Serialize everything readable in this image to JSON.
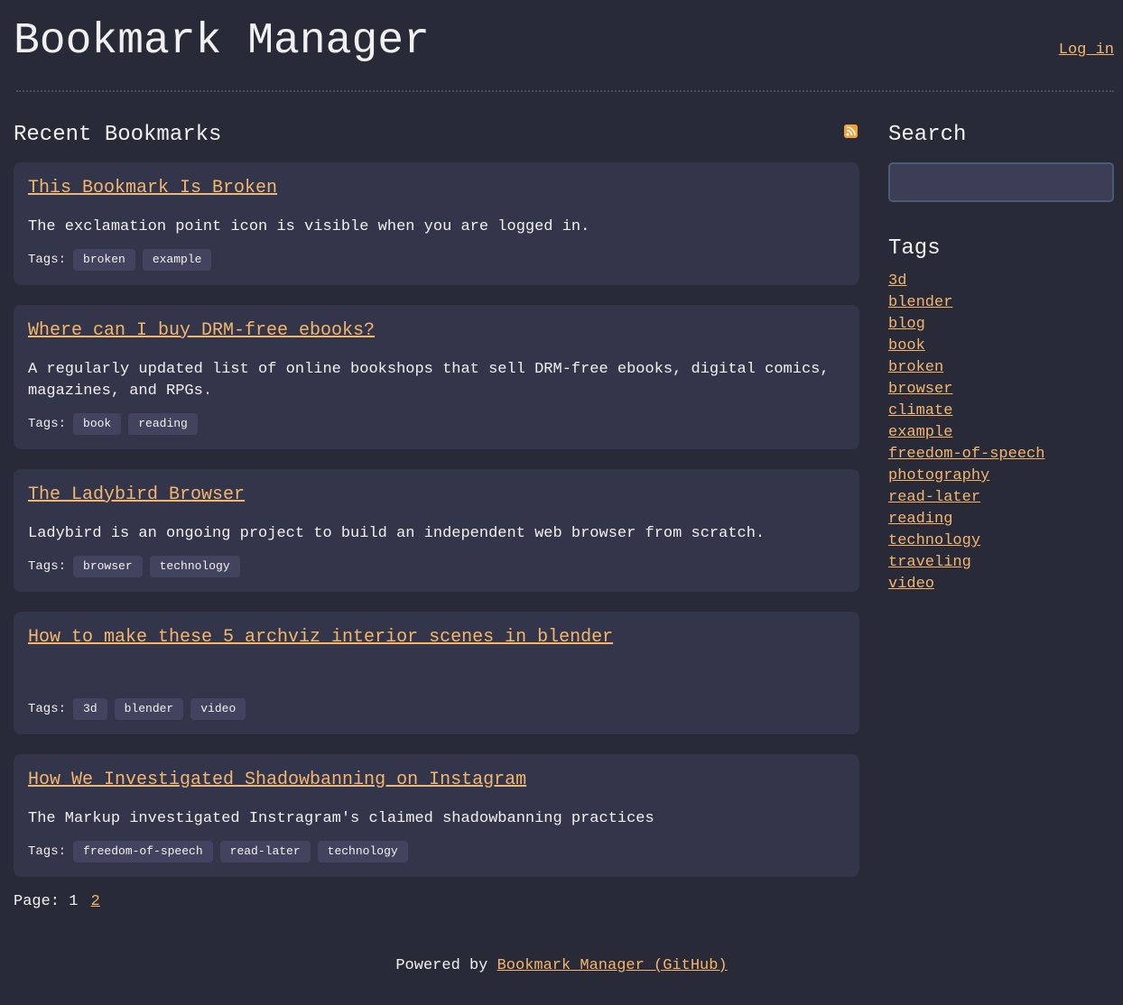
{
  "header": {
    "title": "Bookmark Manager",
    "login_label": "Log in"
  },
  "main": {
    "heading": "Recent Bookmarks",
    "bookmarks": [
      {
        "title": "This Bookmark Is Broken",
        "description": "The exclamation point icon is visible when you are logged in.",
        "tags_label": "Tags:",
        "tags": [
          "broken",
          "example"
        ]
      },
      {
        "title": "Where can I buy DRM-free ebooks?",
        "description": "A regularly updated list of online bookshops that sell DRM-free ebooks, digital comics, magazines, and RPGs.",
        "tags_label": "Tags:",
        "tags": [
          "book",
          "reading"
        ]
      },
      {
        "title": "The Ladybird Browser",
        "description": "Ladybird is an ongoing project to build an independent web browser from scratch.",
        "tags_label": "Tags:",
        "tags": [
          "browser",
          "technology"
        ]
      },
      {
        "title": "How to make these 5 archviz interior scenes in blender",
        "description": "",
        "tags_label": "Tags:",
        "tags": [
          "3d",
          "blender",
          "video"
        ]
      },
      {
        "title": "How We Investigated Shadowbanning on Instagram",
        "description": "The Markup investigated Instragram's claimed shadowbanning practices",
        "tags_label": "Tags:",
        "tags": [
          "freedom-of-speech",
          "read-later",
          "technology"
        ]
      }
    ],
    "pagination": {
      "label": "Page:",
      "current": "1",
      "next": "2"
    }
  },
  "sidebar": {
    "search_heading": "Search",
    "search_value": "",
    "tags_heading": "Tags",
    "tags": [
      "3d",
      "blender",
      "blog",
      "book",
      "broken",
      "browser",
      "climate",
      "example",
      "freedom-of-speech",
      "photography",
      "read-later",
      "reading",
      "technology",
      "traveling",
      "video"
    ]
  },
  "footer": {
    "prefix": "Powered by",
    "link_label": "Bookmark Manager (GitHub)"
  },
  "colors": {
    "background": "#292a37",
    "card": "#33354a",
    "link": "#f4b66e",
    "tag_chip": "#42445f",
    "rss": "#f0a13a"
  },
  "icons": {
    "rss": "rss-feed-icon"
  }
}
